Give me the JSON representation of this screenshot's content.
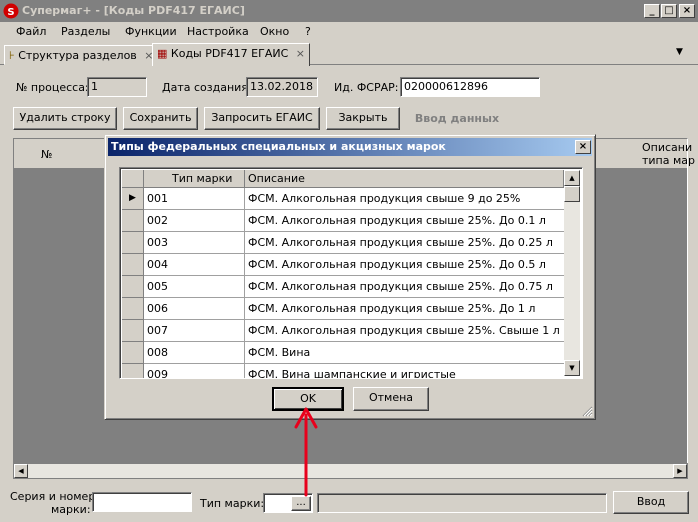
{
  "window": {
    "title": "Супермаг+ - [Коды PDF417 ЕГАИС]",
    "buttons": [
      "_",
      "□",
      "×"
    ]
  },
  "menu": [
    "Файл",
    "Разделы",
    "Функции",
    "Настройка",
    "Окно",
    "?"
  ],
  "tabs": [
    {
      "label": "Структура разделов",
      "active": false
    },
    {
      "label": "Коды PDF417 ЕГАИС",
      "active": true
    }
  ],
  "form": {
    "process_label": "№ процесса:",
    "process_value": "1",
    "created_label": "Дата создания:",
    "created_value": "13.02.2018",
    "fsrar_label": "Ид. ФСРАР:",
    "fsrar_value": "020000612896"
  },
  "toolbar": {
    "delete_row": "Удалить строку",
    "save": "Сохранить",
    "request": "Запросить ЕГАИС",
    "close": "Закрыть",
    "data_entry": "Ввод данных"
  },
  "bg_grid": {
    "col_no": "№",
    "col_desc_line1": "Описани",
    "col_desc_line2": "типа мар"
  },
  "dialog": {
    "title": "Типы федеральных специальных и акцизных марок",
    "columns": [
      "Тип марки",
      "Описание"
    ],
    "rows": [
      {
        "code": "001",
        "desc": "ФСМ. Алкогольная продукция свыше 9 до 25%"
      },
      {
        "code": "002",
        "desc": "ФСМ. Алкогольная продукция свыше 25%. До 0.1 л"
      },
      {
        "code": "003",
        "desc": "ФСМ. Алкогольная продукция свыше 25%. До 0.25 л"
      },
      {
        "code": "004",
        "desc": "ФСМ. Алкогольная продукция свыше 25%. До 0.5 л"
      },
      {
        "code": "005",
        "desc": "ФСМ. Алкогольная продукция свыше 25%. До 0.75 л"
      },
      {
        "code": "006",
        "desc": "ФСМ. Алкогольная продукция свыше 25%. До 1 л"
      },
      {
        "code": "007",
        "desc": "ФСМ. Алкогольная продукция свыше 25%. Свыше 1 л"
      },
      {
        "code": "008",
        "desc": "ФСМ. Вина"
      },
      {
        "code": "009",
        "desc": "ФСМ. Вина шампанские и игристые"
      }
    ],
    "ok": "OK",
    "cancel": "Отмена"
  },
  "bottom": {
    "serial_label_1": "Серия и номер",
    "serial_label_2": "марки:",
    "type_label": "Тип марки:",
    "browse": "...",
    "enter": "Ввод"
  },
  "colors": {
    "annotation_arrow": "#e8001c",
    "dialog_title_start": "#0a246a"
  }
}
